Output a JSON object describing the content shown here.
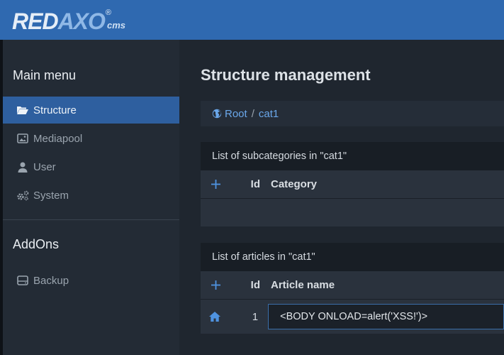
{
  "brand": {
    "part1": "RED",
    "part2": "AXO",
    "reg": "®",
    "suffix": "cms"
  },
  "sidebar": {
    "main_heading": "Main menu",
    "items": [
      {
        "label": "Structure",
        "icon": "folder-open-icon",
        "active": true
      },
      {
        "label": "Mediapool",
        "icon": "image-icon",
        "active": false
      },
      {
        "label": "User",
        "icon": "user-icon",
        "active": false
      },
      {
        "label": "System",
        "icon": "gears-icon",
        "active": false
      }
    ],
    "addons_heading": "AddOns",
    "addons": [
      {
        "label": "Backup",
        "icon": "hdd-icon"
      }
    ]
  },
  "main": {
    "title": "Structure management",
    "breadcrumb": {
      "root": "Root",
      "separator": "/",
      "current": "cat1"
    },
    "categories": {
      "heading": "List of subcategories in \"cat1\"",
      "columns": {
        "id": "Id",
        "name": "Category"
      }
    },
    "articles": {
      "heading": "List of articles in \"cat1\"",
      "columns": {
        "id": "Id",
        "name": "Article name"
      },
      "rows": [
        {
          "id": "1",
          "name": "<BODY ONLOAD=alert('XSS!')>"
        }
      ]
    }
  },
  "colors": {
    "accent": "#2f69b0",
    "link": "#6aa7ea",
    "active_item": "#2e5f9f"
  }
}
